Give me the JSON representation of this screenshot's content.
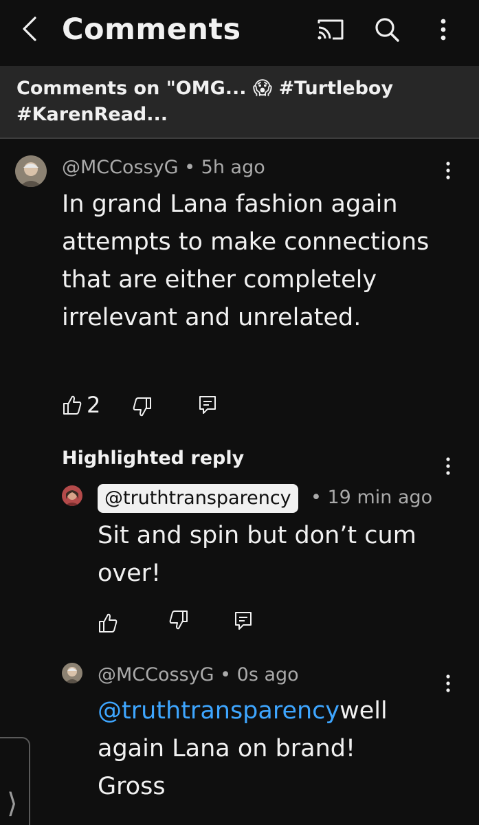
{
  "header": {
    "title": "Comments"
  },
  "subheader": {
    "text": "Comments on \"OMG... 😱 #Turtleboy #KarenRead..."
  },
  "comment": {
    "author": "@MCCossyG",
    "age": "5h ago",
    "text": "In grand Lana fashion again attempts to make connections that are either completely irrelevant and unrelated.",
    "likes": "2"
  },
  "highlighted": {
    "label": "Highlighted reply",
    "author": "@truthtransparency",
    "age": "• 19 min ago",
    "text": "Sit and spin but don’t cum over!"
  },
  "reply": {
    "author": "@MCCossyG",
    "age": "0s ago",
    "mention": "@truthtransparency",
    "text": "well again Lana on brand! Gross"
  },
  "side_tab": {
    "arrow": "⟩"
  }
}
